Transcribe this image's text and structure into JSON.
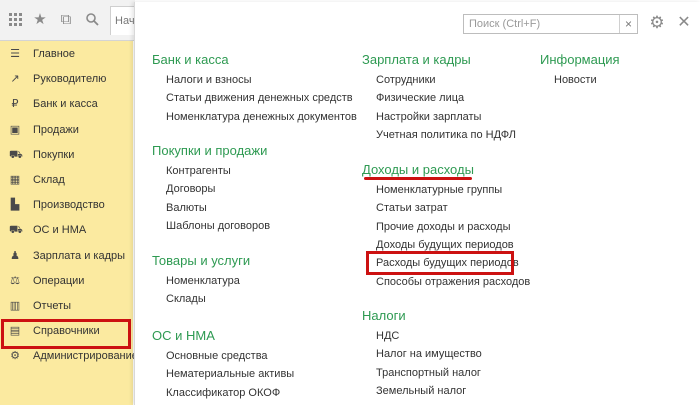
{
  "topbar": {
    "tab_stub_label": "Нач",
    "icons": [
      "apps-grid-icon",
      "star-icon",
      "history-icon",
      "search-icon"
    ]
  },
  "sidebar": {
    "items": [
      {
        "label": "Главное",
        "icon": "list-icon"
      },
      {
        "label": "Руководителю",
        "icon": "trend-icon"
      },
      {
        "label": "Банк и касса",
        "icon": "ruble-icon"
      },
      {
        "label": "Продажи",
        "icon": "bag-icon"
      },
      {
        "label": "Покупки",
        "icon": "cart-icon"
      },
      {
        "label": "Склад",
        "icon": "warehouse-icon"
      },
      {
        "label": "Производство",
        "icon": "factory-icon"
      },
      {
        "label": "ОС и НМА",
        "icon": "truck-icon"
      },
      {
        "label": "Зарплата и кадры",
        "icon": "person-icon"
      },
      {
        "label": "Операции",
        "icon": "operations-icon"
      },
      {
        "label": "Отчеты",
        "icon": "bar-chart-icon"
      },
      {
        "label": "Справочники",
        "icon": "book-icon"
      },
      {
        "label": "Администрирование",
        "icon": "gear-icon"
      }
    ],
    "active_label": "Справочники"
  },
  "search": {
    "placeholder": "Поиск (Ctrl+F)",
    "value": "",
    "clear_glyph": "×"
  },
  "panel_icons": {
    "settings": "⚙",
    "close": "✕"
  },
  "columns": {
    "left": [
      {
        "title": "Банк и касса",
        "links": [
          "Налоги и взносы",
          "Статьи движения денежных средств",
          "Номенклатура денежных документов"
        ]
      },
      {
        "title": "Покупки и продажи",
        "links": [
          "Контрагенты",
          "Договоры",
          "Валюты",
          "Шаблоны договоров"
        ]
      },
      {
        "title": "Товары и услуги",
        "links": [
          "Номенклатура",
          "Склады"
        ]
      },
      {
        "title": "ОС и НМА",
        "links": [
          "Основные средства",
          "Нематериальные активы",
          "Классификатор ОКОФ"
        ]
      }
    ],
    "middle": [
      {
        "title": "Зарплата и кадры",
        "links": [
          "Сотрудники",
          "Физические лица",
          "Настройки зарплаты",
          "Учетная политика по НДФЛ"
        ]
      },
      {
        "title": "Доходы и расходы",
        "links": [
          "Номенклатурные группы",
          "Статьи затрат",
          "Прочие доходы и расходы",
          "Доходы будущих периодов",
          "Расходы будущих периодов",
          "Способы отражения расходов"
        ]
      },
      {
        "title": "Налоги",
        "links": [
          "НДС",
          "Налог на имущество",
          "Транспортный налог",
          "Земельный налог"
        ]
      }
    ],
    "right": [
      {
        "title": "Информация",
        "links": [
          "Новости"
        ]
      }
    ]
  },
  "highlight": {
    "color": "#cc1111",
    "link": "Расходы будущих периодов",
    "section": "Доходы и расходы"
  },
  "colors": {
    "sidebar_bg": "#fbeaa0",
    "section_title": "#2e9a52"
  }
}
